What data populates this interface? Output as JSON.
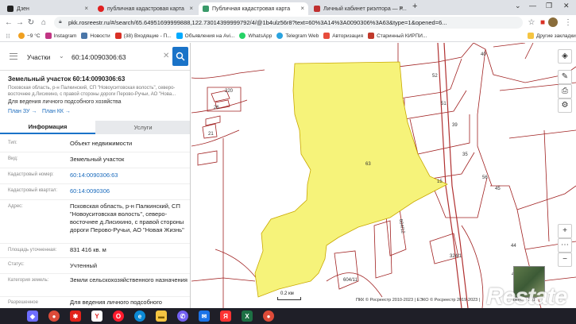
{
  "browser": {
    "tabs": [
      {
        "title": "Дзен",
        "favicon_color": "#222222",
        "active": false
      },
      {
        "title": "публичная кадастровая карта",
        "favicon_color": "#e02020",
        "active": false
      },
      {
        "title": "Публичная кадастровая карта",
        "favicon_color": "#3a9a6a",
        "active": true
      },
      {
        "title": "Личный кабинет риэлтора — Р...",
        "favicon_color": "#c03030",
        "active": false
      }
    ],
    "new_tab": "+",
    "url": "pkk.rosreestr.ru/#/search/65.64951699999888,122.73014399999792/4/@1b4ulz56r8?text=60%3A14%3A0090306%3A63&type=1&opened=6...",
    "bookmarks": [
      {
        "label": "−9 °C",
        "icon_color": "#f0a020"
      },
      {
        "label": "Instagram",
        "icon_color": "#c13584"
      },
      {
        "label": "Новости",
        "icon_color": "#4a76a8"
      },
      {
        "label": "(38) Входящие - П...",
        "icon_color": "#d93025"
      },
      {
        "label": "Объявления на Avi...",
        "icon_color": "#00aaff"
      },
      {
        "label": "WhatsApp",
        "icon_color": "#25d366"
      },
      {
        "label": "Telegram Web",
        "icon_color": "#2aa3df"
      },
      {
        "label": "Авторизация",
        "icon_color": "#e74c3c"
      },
      {
        "label": "Старинный КИРПИ...",
        "icon_color": "#c0392b"
      }
    ],
    "other_bookmarks": "Другие закладки"
  },
  "panel": {
    "search_type": "Участки",
    "search_query": "60:14:0090306:63",
    "title": "Земельный участок 60:14:0090306:63",
    "address_short": "Псковская область, р-н Палкинский, СП \"Новоуситовская волость\", северо-восточнее д.Лисихино, с правой стороны дороги Перово-Ручьи, АО \"Нова...",
    "purpose": "Для ведения личного подсобного хозяйства",
    "plan_zu": "План ЗУ →",
    "plan_kk": "План КК →",
    "tab_info": "Информация",
    "tab_services": "Услуги",
    "rows": [
      {
        "key": "Тип:",
        "value": "Объект недвижимости"
      },
      {
        "key": "Вид:",
        "value": "Земельный участок"
      },
      {
        "key": "Кадастровый номер:",
        "value": "60:14:0090306:63"
      },
      {
        "key": "Кадастровый квартал:",
        "value": "60:14:0090306"
      },
      {
        "key": "Адрес:",
        "value": "Псковская область, р-н Палкинский, СП \"Новоуситовская волость\", северо-восточнее д.Лисихино, с правой стороны дороги Перово-Ручьи, АО \"Новая Жизнь\""
      },
      {
        "key": "Площадь уточненная:",
        "value": "831 416 кв. м"
      },
      {
        "key": "Статус:",
        "value": "Учтенный"
      },
      {
        "key": "Категория земель:",
        "value": "Земли сельскохозяйственного назначения"
      },
      {
        "key": "Разрешенное",
        "value": "Для ведения личного подсобного"
      }
    ]
  },
  "map": {
    "parcel_labels": [
      "63",
      "40",
      "52",
      "51",
      "39",
      "35",
      "56",
      "45",
      "44",
      "43",
      "220",
      "604/12",
      "604/11",
      "324/1",
      "21",
      "26",
      "15"
    ],
    "scale": "0.2 км",
    "copyright": "ПКК © Росреестр 2010-2023 | ЕЭКО © Росреестр 2019-2023 |",
    "copyright_tail": "реестр 2010",
    "highlight_color": "#f6f37a",
    "boundary_color": "#a02020"
  },
  "watermark": "Restate",
  "taskbar": {
    "icons": [
      {
        "name": "start-icon",
        "color": "#6d6dff",
        "glyph": "◆"
      },
      {
        "name": "chrome-icon",
        "color": "#dd4b39",
        "glyph": "●"
      },
      {
        "name": "huawei-icon",
        "color": "#e2231a",
        "glyph": "✱"
      },
      {
        "name": "yandex-icon",
        "color": "#ffffff",
        "glyph": "Y"
      },
      {
        "name": "opera-icon",
        "color": "#ff1b2d",
        "glyph": "O"
      },
      {
        "name": "edge-icon",
        "color": "#0c8ad6",
        "glyph": "e"
      },
      {
        "name": "files-icon",
        "color": "#f5c542",
        "glyph": "▬"
      },
      {
        "name": "viber-icon",
        "color": "#7360f2",
        "glyph": "✆"
      },
      {
        "name": "mail-icon",
        "color": "#1b73e8",
        "glyph": "✉"
      },
      {
        "name": "yandex-browser-icon",
        "color": "#ff3333",
        "glyph": "Я"
      },
      {
        "name": "excel-icon",
        "color": "#1d7044",
        "glyph": "X"
      },
      {
        "name": "chrome2-icon",
        "color": "#dd4b39",
        "glyph": "●"
      }
    ]
  }
}
